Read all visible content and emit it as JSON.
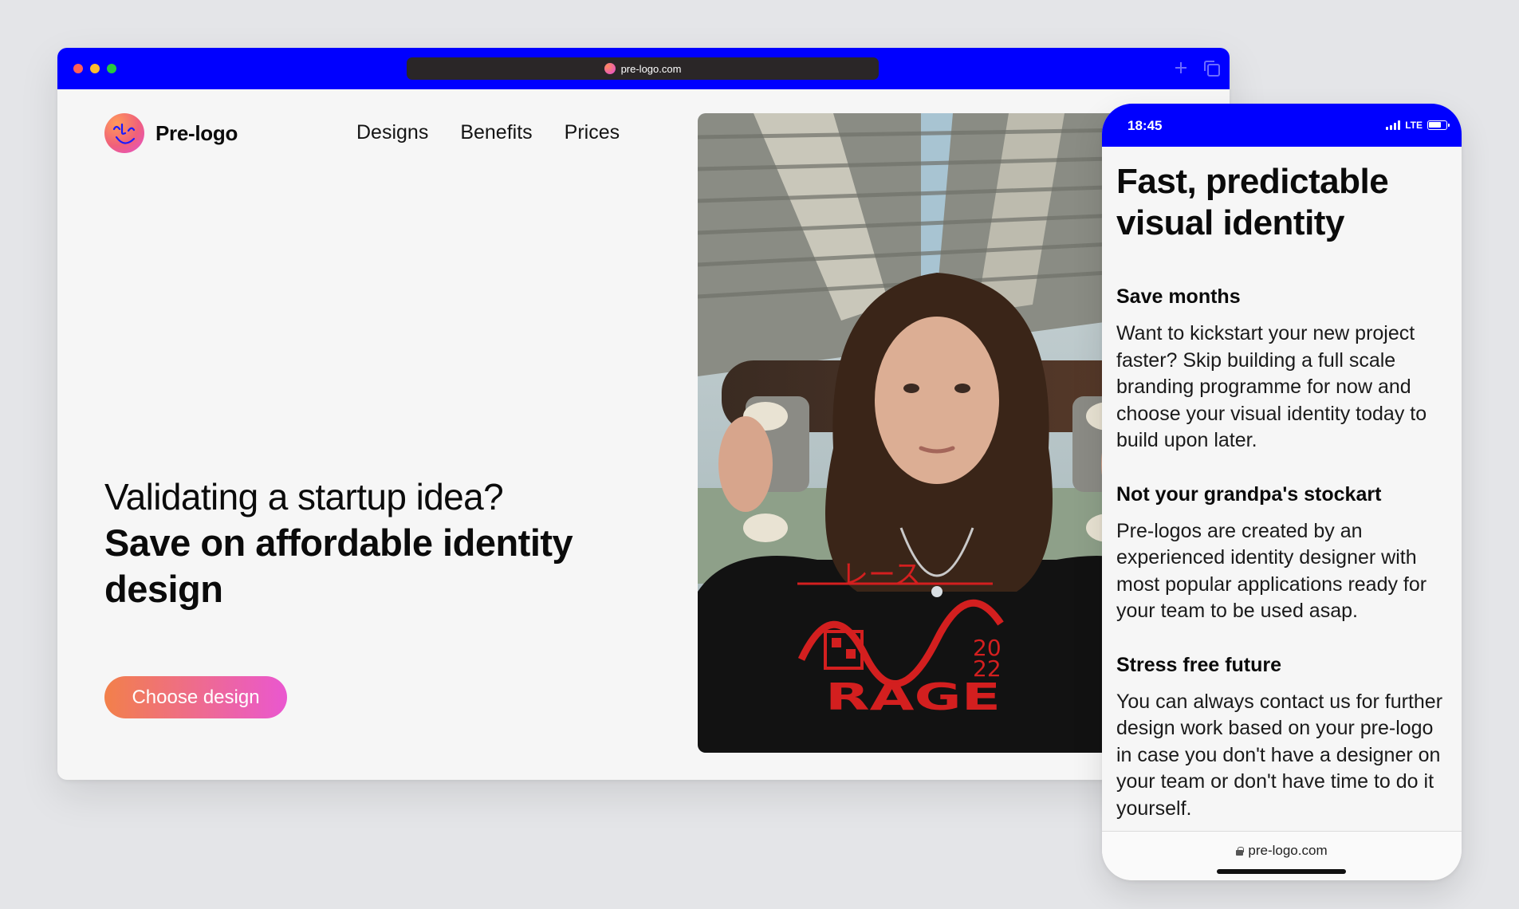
{
  "browser": {
    "url": "pre-logo.com"
  },
  "site": {
    "brand": "Pre-logo",
    "nav": [
      {
        "label": "Designs"
      },
      {
        "label": "Benefits"
      },
      {
        "label": "Prices"
      }
    ],
    "hero": {
      "lead": "Validating a startup idea?",
      "strong": "Save on affordable identity design"
    },
    "cta_label": "Choose design",
    "photo_shirt_text": "RAGE",
    "photo_shirt_year": [
      "20",
      "22"
    ],
    "photo_shirt_katakana": "レース"
  },
  "phone": {
    "time": "18:45",
    "network": "LTE",
    "title": "Fast, predictable visual identity",
    "features": [
      {
        "title": "Save months",
        "body": "Want to kickstart your new project faster? Skip building a full scale branding programme for now and choose your visual identity today to build upon later."
      },
      {
        "title": "Not your grandpa's stockart",
        "body": "Pre-logos are created by an experienced identity designer with most popular applications ready for your team to be used asap."
      },
      {
        "title": "Stress free future",
        "body": "You can always contact us for further design work based on your pre-logo in case you don't have a designer on your team or don't have time to do it yourself."
      }
    ],
    "url": "pre-logo.com"
  },
  "colors": {
    "chrome_blue": "#0000ff",
    "cta_gradient_start": "#f2804a",
    "cta_gradient_end": "#ea57d0",
    "page_bg": "#f6f6f6"
  }
}
